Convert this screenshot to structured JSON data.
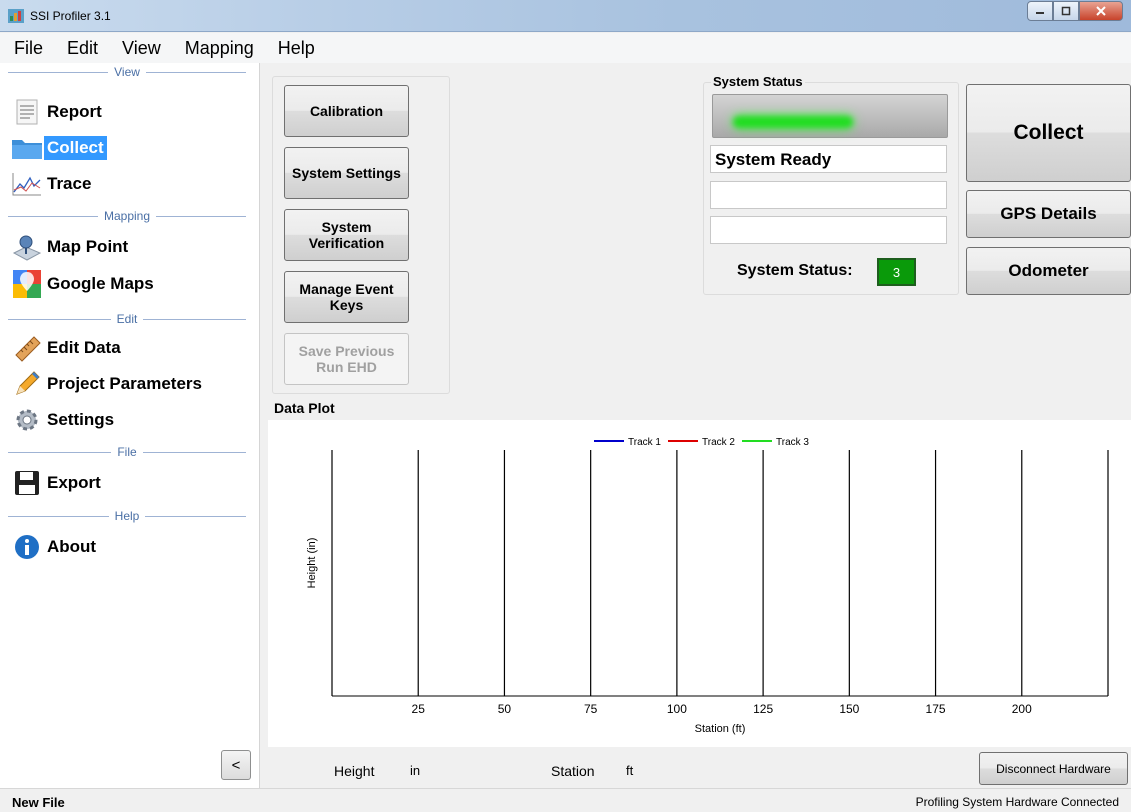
{
  "window": {
    "title": "SSI Profiler 3.1",
    "icon": "ssi-app-icon"
  },
  "menu": [
    "File",
    "Edit",
    "View",
    "Mapping",
    "Help"
  ],
  "sidebar": {
    "sections": {
      "view": "View",
      "mapping": "Mapping",
      "edit": "Edit",
      "file": "File",
      "help": "Help"
    },
    "items": [
      {
        "label": "Report",
        "icon": "report-icon"
      },
      {
        "label": "Collect",
        "icon": "folder-icon",
        "active": true
      },
      {
        "label": "Trace",
        "icon": "trace-chart-icon"
      },
      {
        "label": "Map Point",
        "icon": "map-point-icon"
      },
      {
        "label": "Google Maps",
        "icon": "google-maps-icon"
      },
      {
        "label": "Edit Data",
        "icon": "ruler-icon"
      },
      {
        "label": "Project Parameters",
        "icon": "pencil-icon"
      },
      {
        "label": "Settings",
        "icon": "gear-icon"
      },
      {
        "label": "Export",
        "icon": "floppy-disk-icon"
      },
      {
        "label": "About",
        "icon": "info-icon"
      }
    ],
    "collapse_label": "<"
  },
  "buttons": {
    "calibration": "Calibration",
    "system_settings": "System Settings",
    "system_verification": "System Verification",
    "manage_event_keys": "Manage Event Keys",
    "save_previous": "Save Previous Run EHD"
  },
  "status": {
    "group_title": "System Status",
    "ready_text": "System Ready",
    "line2": "",
    "line3": "",
    "count_label": "System Status:",
    "count_value": "3",
    "indicator_color": "#22dd22"
  },
  "right_buttons": {
    "collect": "Collect",
    "gps": "GPS Details",
    "odometer": "Odometer"
  },
  "plot": {
    "title": "Data Plot"
  },
  "chart_data": {
    "type": "line",
    "series": [
      {
        "name": "Track 1",
        "color": "#0000cc",
        "values": []
      },
      {
        "name": "Track 2",
        "color": "#dd0000",
        "values": []
      },
      {
        "name": "Track 3",
        "color": "#22dd22",
        "values": []
      }
    ],
    "xlabel": "Station (ft)",
    "ylabel": "Height (in)",
    "xlim": [
      0,
      225
    ],
    "xticks": [
      25,
      50,
      75,
      100,
      125,
      150,
      175,
      200
    ],
    "vertical_lines": [
      0,
      25,
      50,
      75,
      100,
      125,
      150,
      175,
      200,
      225
    ],
    "legend": "top-center"
  },
  "readouts": {
    "height_label": "Height",
    "height_unit": "in",
    "station_label": "Station",
    "station_unit": "ft"
  },
  "disconnect_label": "Disconnect Hardware",
  "statusbar": {
    "left": "New File",
    "right": "Profiling System Hardware Connected"
  }
}
